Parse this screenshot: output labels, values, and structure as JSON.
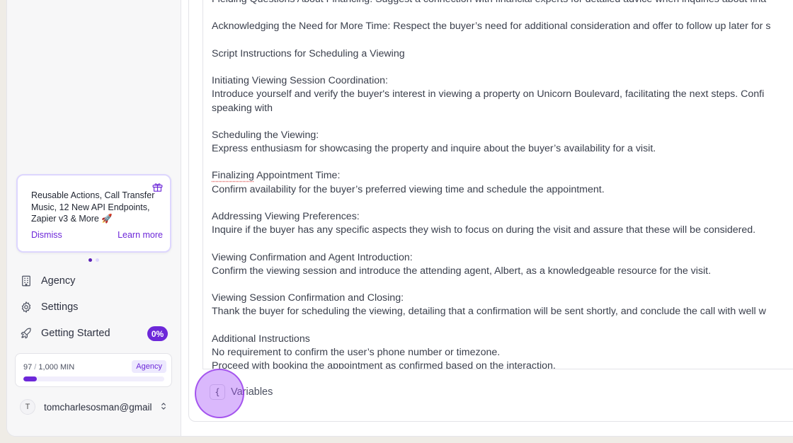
{
  "promo": {
    "text": "Reusable Actions, Call Transfer Music, 12 New API Endpoints, Zapier v3 & More 🚀",
    "dismiss": "Dismiss",
    "learn_more": "Learn more",
    "icon": "gift-icon"
  },
  "nav": {
    "agency": "Agency",
    "settings": "Settings",
    "getting_started": "Getting Started",
    "getting_started_badge": "0%"
  },
  "usage": {
    "used": "97",
    "total": "1,000 MIN",
    "plan": "Agency",
    "fraction": 0.097
  },
  "user": {
    "initial": "T",
    "email": "tomcharlesosman@gmail"
  },
  "editor": {
    "lines": [
      "Fielding Questions About Financing: Suggest a connection with financial experts for detailed advice when inquiries about fina",
      "",
      "Acknowledging the Need for More Time: Respect the buyer’s need for additional consideration and offer to follow up later for s",
      "",
      "Script Instructions for Scheduling a Viewing",
      "",
      "Initiating Viewing Session Coordination:",
      "Introduce yourself and verify the buyer's interest in viewing a property on Unicorn Boulevard, facilitating the next steps. Confi",
      "speaking with",
      "",
      "Scheduling the Viewing:",
      "Express enthusiasm for showcasing the property and inquire about the buyer’s availability for a visit.",
      "",
      "Finalizing Appointment Time:",
      "Confirm availability for the buyer’s preferred viewing time and schedule the appointment.",
      "",
      "Addressing Viewing Preferences:",
      "Inquire if the buyer has any specific aspects they wish to focus on during the visit and assure that these will be considered.",
      "",
      "Viewing Confirmation and Agent Introduction:",
      "Confirm the viewing session and introduce the attending agent, Albert, as a knowledgeable resource for the visit.",
      "",
      "Viewing Session Confirmation and Closing:",
      "Thank the buyer for scheduling the viewing, detailing that a confirmation will be sent shortly, and conclude the call with well w",
      "",
      "Additional Instructions",
      "No requirement to confirm the user’s phone number or timezone.",
      "Proceed with booking the appointment as confirmed based on the interaction."
    ]
  },
  "variables": {
    "brace": "{",
    "label": "Variables"
  },
  "colors": {
    "accent": "#6d28d9",
    "accent_light": "#ede9fe",
    "cursor_highlight": "#a855f7"
  }
}
